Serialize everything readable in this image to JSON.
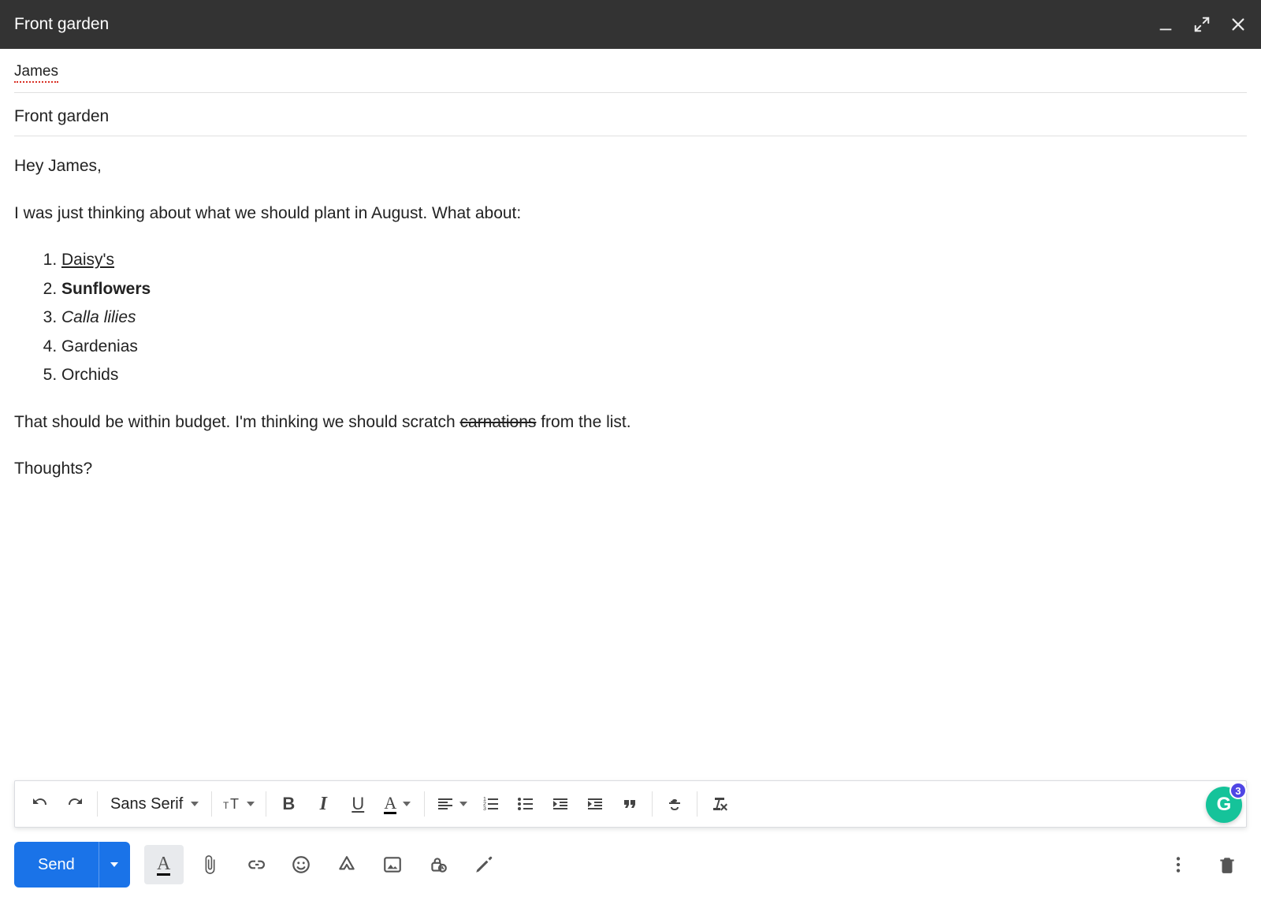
{
  "titlebar": {
    "title": "Front garden"
  },
  "compose": {
    "to": "James",
    "subject": "Front garden",
    "body": {
      "greeting": "Hey James,",
      "intro": "I was just thinking about what we should plant in August. What about:",
      "items": [
        {
          "text": "Daisy's",
          "style": "underline"
        },
        {
          "text": "Sunflowers",
          "style": "bold"
        },
        {
          "text": "Calla lilies",
          "style": "italic"
        },
        {
          "text": "Gardenias",
          "style": "none"
        },
        {
          "text": "Orchids",
          "style": "none"
        }
      ],
      "budget_pre": "That should be within budget. I'm thinking we should scratch ",
      "budget_strike": "carnations",
      "budget_post": " from the list.",
      "closing": "Thoughts?"
    }
  },
  "format_toolbar": {
    "font": "Sans Serif"
  },
  "actions": {
    "send": "Send"
  },
  "grammarly": {
    "count": "3",
    "glyph": "G"
  }
}
